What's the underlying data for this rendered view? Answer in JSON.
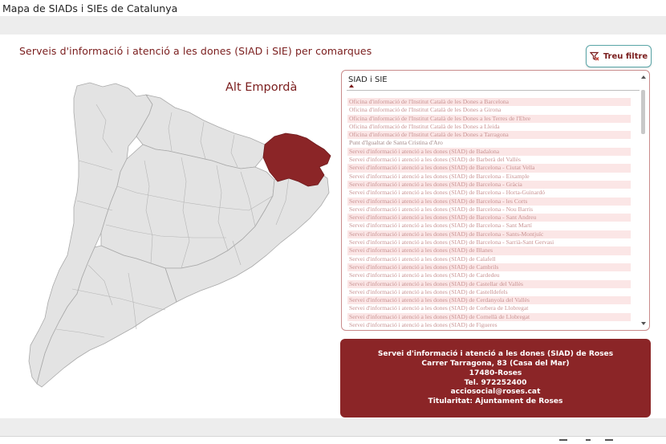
{
  "window": {
    "title": "Mapa de SIADs i SIEs de Catalunya"
  },
  "page": {
    "heading": "Serveis d'informació i atenció a les dones (SIAD i SIE) per comarques"
  },
  "filter_button": {
    "label": "Treu filtre",
    "icon": "filter-clear-icon"
  },
  "map": {
    "selected_region": "Alt Empordà",
    "colors": {
      "region_fill": "#e3e3e3",
      "region_stroke": "#a9a9a9",
      "selected_fill": "#8b2527"
    }
  },
  "list": {
    "header": "SIAD i SIE",
    "sort": "ascending",
    "items": [
      "Oficina d'informació de l'Institut Català de les Dones a Barcelona",
      "Oficina d'informació de l'Institut Català de les Dones a Girona",
      "Oficina d'informació de l'Institut Català de les Dones a les Terres de l'Ebre",
      "Oficina d'informació de l'Institut Català de les Dones a Lleida",
      "Oficina d'informació de l'Institut Català de les Dones a Tarragona",
      "Punt d'Igualtat de Santa Cristina d'Aro",
      "Servei d'informació i atenció a les dones (SIAD) de Badalona",
      "Servei d'informació i atenció a les dones (SIAD) de Barberà del Vallès",
      "Servei d'informació i atenció a les dones (SIAD) de Barcelona - Ciutat Vella",
      "Servei d'informació i atenció a les dones (SIAD) de Barcelona - Eixample",
      "Servei d'informació i atenció a les dones (SIAD) de Barcelona - Gràcia",
      "Servei d'informació i atenció a les dones (SIAD) de Barcelona - Horta-Guinardó",
      "Servei d'informació i atenció a les dones (SIAD) de Barcelona - les Corts",
      "Servei d'informació i atenció a les dones (SIAD) de Barcelona - Nou Barris",
      "Servei d'informació i atenció a les dones (SIAD) de Barcelona - Sant Andreu",
      "Servei d'informació i atenció a les dones (SIAD) de Barcelona - Sant Martí",
      "Servei d'informació i atenció a les dones (SIAD) de Barcelona - Sants-Montjuïc",
      "Servei d'informació i atenció a les dones (SIAD) de Barcelona - Sarrià-Sant Gervasi",
      "Servei d'informació i atenció a les dones (SIAD) de Blanes",
      "Servei d'informació i atenció a les dones (SIAD) de Calafell",
      "Servei d'informació i atenció a les dones (SIAD) de Cambrils",
      "Servei d'informació i atenció a les dones (SIAD) de Cardedeu",
      "Servei d'informació i atenció a les dones (SIAD) de Castellar del Vallès",
      "Servei d'informació i atenció a les dones (SIAD) de Castelldefels",
      "Servei d'informació i atenció a les dones (SIAD) de Cerdanyola del Vallès",
      "Servei d'informació i atenció a les dones (SIAD) de Corbera de Llobregat",
      "Servei d'informació i atenció a les dones (SIAD) de Cornellà de Llobregat",
      "Servei d'informació i atenció a les dones (SIAD) de Figueres"
    ]
  },
  "detail": {
    "name": "Servei d'informació i atenció a les dones (SIAD) de Roses",
    "address": "Carrer Tarragona, 83 (Casa del Mar)",
    "postal": "17480-Roses",
    "phone": "Tel. 972252400",
    "email": "acciosocial@roses.cat",
    "owner": "Titularitat: Ajuntament de Roses",
    "color": "#8b2527"
  }
}
